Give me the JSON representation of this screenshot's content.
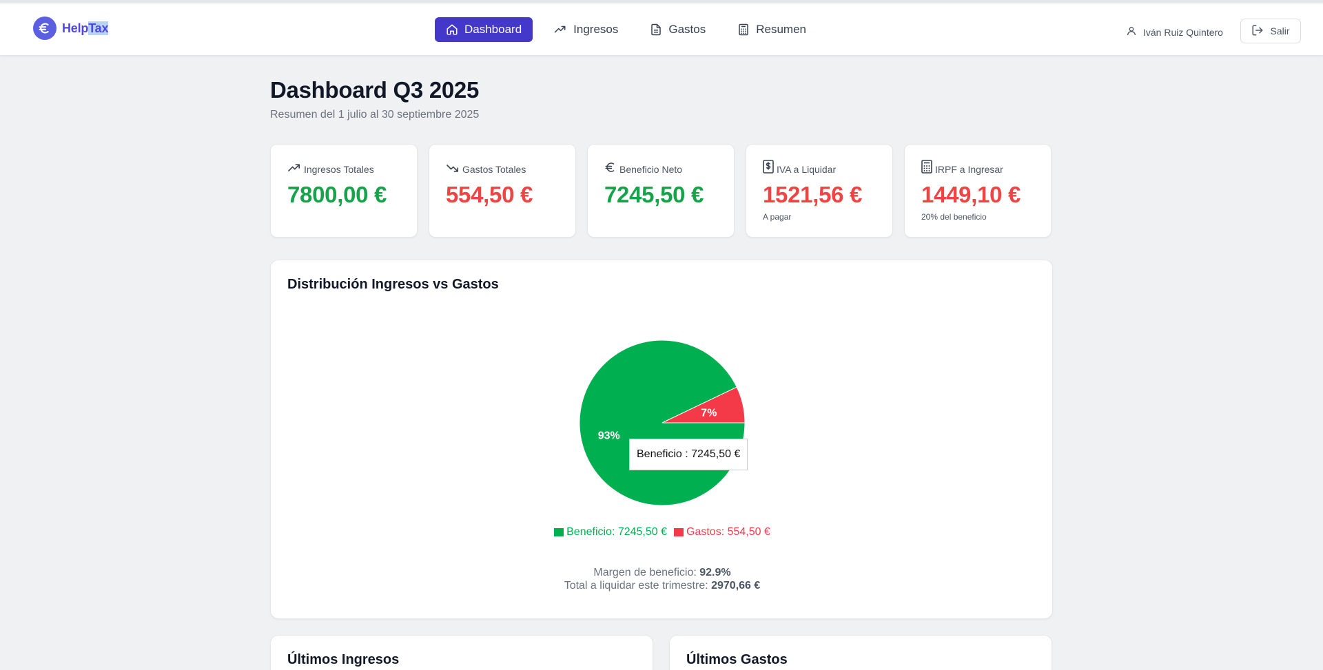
{
  "brand": {
    "name_a": "Help",
    "name_b": "Tax",
    "color": "#4f46e5"
  },
  "nav": {
    "items": [
      {
        "label": "Dashboard",
        "icon": "home-icon",
        "active": true
      },
      {
        "label": "Ingresos",
        "icon": "trending-up-icon",
        "active": false
      },
      {
        "label": "Gastos",
        "icon": "file-text-icon",
        "active": false
      },
      {
        "label": "Resumen",
        "icon": "calculator-icon",
        "active": false
      }
    ]
  },
  "user": {
    "name": "Iván Ruiz Quintero",
    "logout_label": "Salir"
  },
  "page": {
    "title": "Dashboard Q3 2025",
    "subtitle": "Resumen del 1 julio al 30 septiembre 2025"
  },
  "stats": [
    {
      "label": "Ingresos Totales",
      "value": "7800,00 €",
      "note": "",
      "icon": "trending-up-icon",
      "tone": "green"
    },
    {
      "label": "Gastos Totales",
      "value": "554,50 €",
      "note": "",
      "icon": "trending-down-icon",
      "tone": "red"
    },
    {
      "label": "Beneficio Neto",
      "value": "7245,50 €",
      "note": "",
      "icon": "euro-icon",
      "tone": "green"
    },
    {
      "label": "IVA a Liquidar",
      "value": "1521,56 €",
      "note": "A pagar",
      "icon": "receipt-dollar-icon",
      "tone": "red"
    },
    {
      "label": "IRPF a Ingresar",
      "value": "1449,10 €",
      "note": "20% del beneficio",
      "icon": "calculator-icon",
      "tone": "red"
    }
  ],
  "chart_card": {
    "title": "Distribución Ingresos vs Gastos",
    "tooltip": "Beneficio : 7245,50 €",
    "summary": {
      "margin_label": "Margen de beneficio: ",
      "margin_value": "92.9%",
      "total_label": "Total a liquidar este trimestre: ",
      "total_value": "2970,66 €"
    }
  },
  "chart_data": {
    "type": "pie",
    "title": "Distribución Ingresos vs Gastos",
    "slices": [
      {
        "name": "Beneficio",
        "value": 7245.5,
        "percent_label": "93%",
        "legend": "Beneficio: 7245,50 €",
        "color": "#00b050"
      },
      {
        "name": "Gastos",
        "value": 554.5,
        "percent_label": "7%",
        "legend": "Gastos: 554,50 €",
        "color": "#f43a48"
      }
    ],
    "legend_position": "bottom"
  },
  "bottom_cards": {
    "left_title": "Últimos Ingresos",
    "right_title": "Últimos Gastos"
  },
  "colors": {
    "accent": "#4338ca",
    "positive": "#16a34a",
    "negative": "#ef4444",
    "background": "#f0f1f3"
  }
}
